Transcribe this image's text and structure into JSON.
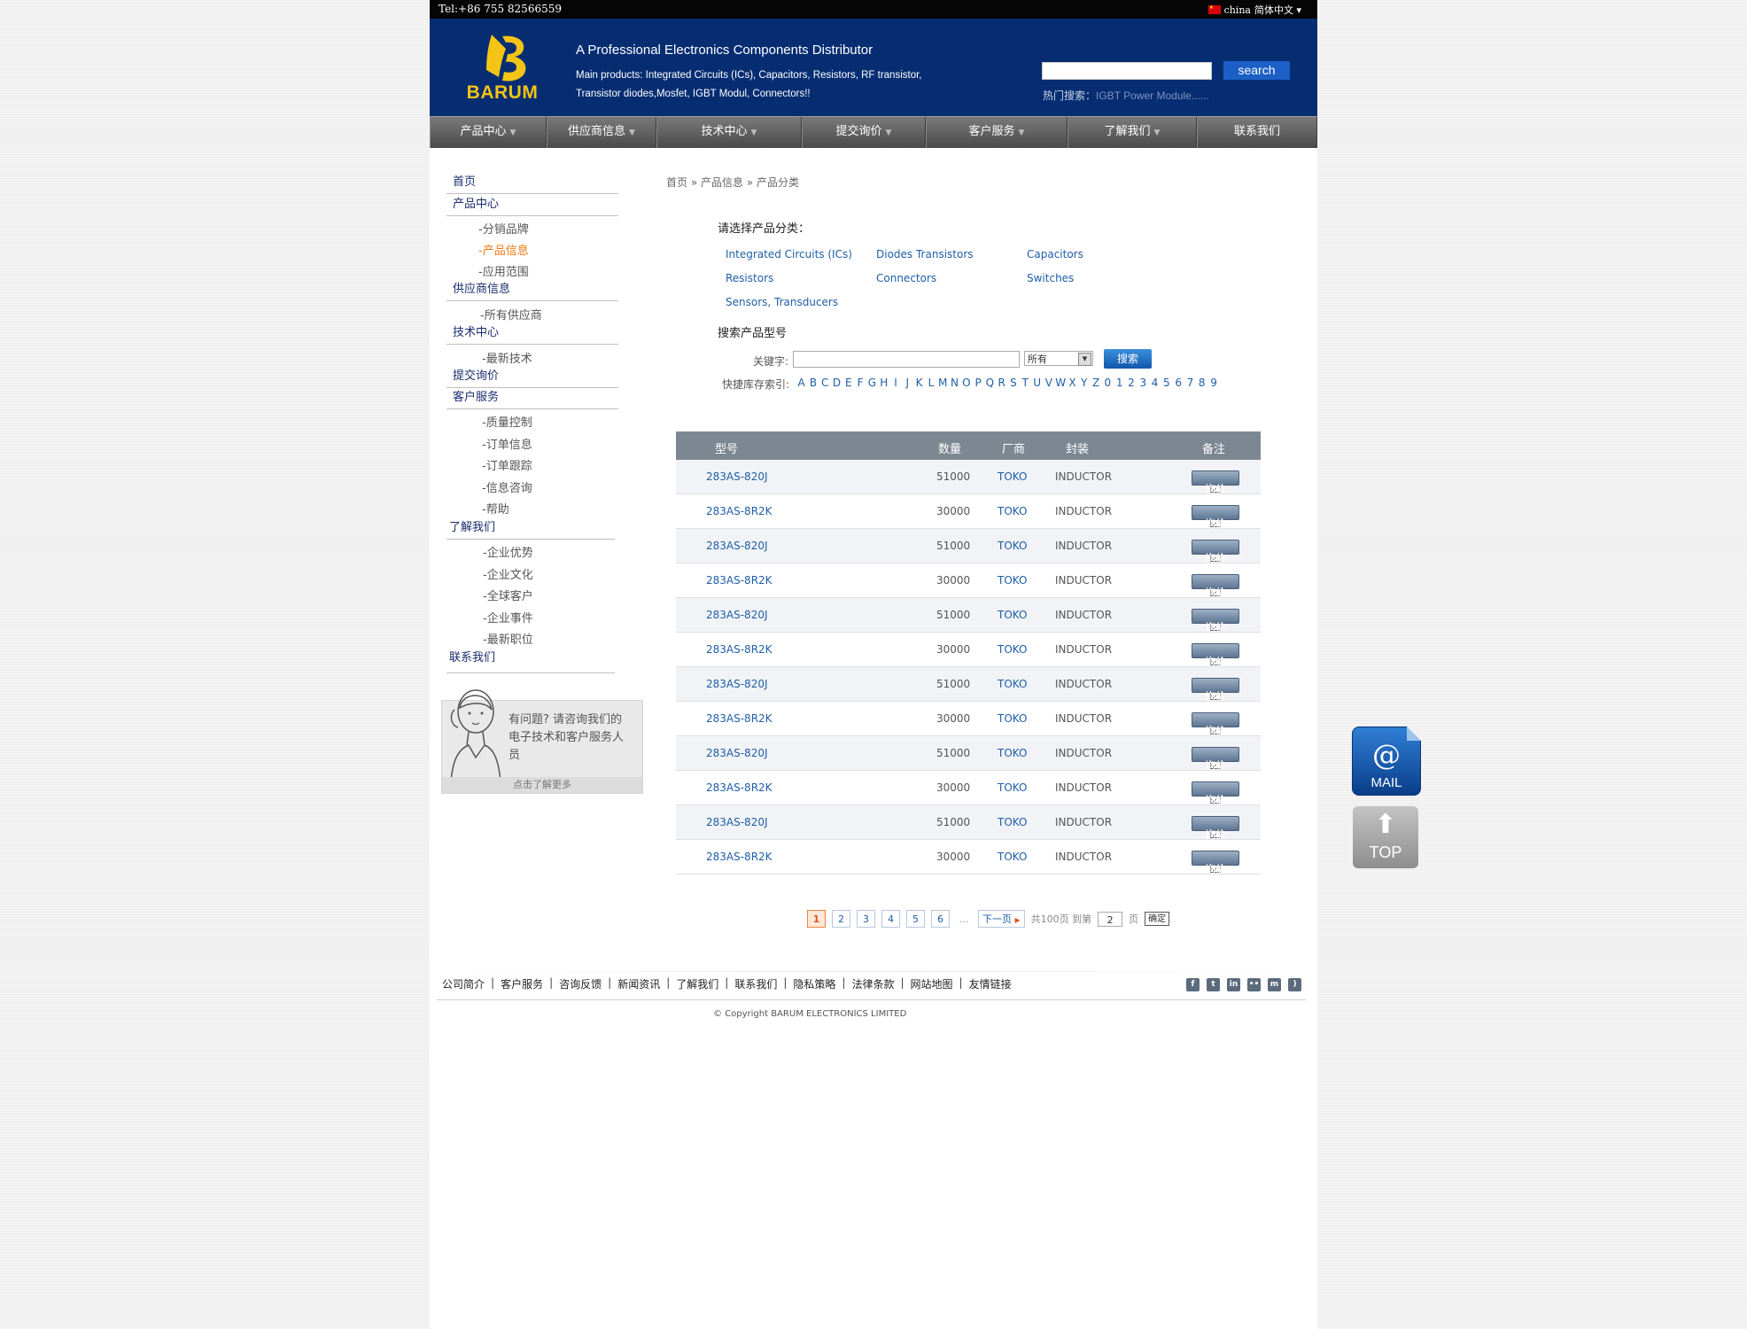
{
  "topbar": {
    "tel": "Tel:+86 755 82566559",
    "region": "china",
    "language": "简体中文 ▾"
  },
  "header": {
    "logo_text": "BARUM",
    "tagline": "A Professional Electronics Components Distributor",
    "main_products": "Main products: Integrated Circuits (ICs), Capacitors, Resistors, RF transistor, Transistor diodes,Mosfet, IGBT Modul, Connectors!!",
    "search_button": "search",
    "search_value": "",
    "hot_label": "热门搜索：",
    "hot_value": "IGBT Power Module......"
  },
  "nav": [
    "产品中心",
    "供应商信息",
    "技术中心",
    "提交询价",
    "客户服务",
    "了解我们",
    "联系我们"
  ],
  "sidebar": {
    "home": "首页",
    "product_center": "产品中心",
    "brands": "-分销品牌",
    "product_info": "-产品信息",
    "application": "-应用范围",
    "supplier_info": "供应商信息",
    "all_suppliers": "-所有供应商",
    "tech_center": "技术中心",
    "latest_tech": "-最新技术",
    "submit_inquiry": "提交询价",
    "customer_service": "客户服务",
    "quality": "-质量控制",
    "order_info": "-订单信息",
    "order_track": "-订单跟踪",
    "info_consult": "-信息咨询",
    "help": "-帮助",
    "about": "了解我们",
    "advantage": "-企业优势",
    "culture": "-企业文化",
    "global_clients": "-全球客户",
    "events": "-企业事件",
    "jobs": "-最新职位",
    "contact": "联系我们",
    "help_box_text": "有问题? 请咨询我们的电子技术和客户服务人员",
    "help_box_more": "点击了解更多"
  },
  "breadcrumb": "首页 » 产品信息 » 产品分类",
  "categories": {
    "title": "请选择产品分类：",
    "items": [
      "Integrated Circuits (ICs)",
      "Diodes Transistors",
      "Capacitors",
      "Resistors",
      "Connectors",
      "Switches",
      "Sensors, Transducers"
    ]
  },
  "search": {
    "title": "搜索产品型号",
    "keyword_label": "关键字:",
    "keyword_value": "",
    "select_value": "所有",
    "button": "搜索",
    "quick_label": "快捷库存索引:",
    "letters": [
      "A",
      "B",
      "C",
      "D",
      "E",
      "F",
      "G",
      "H",
      "I",
      "J",
      "K",
      "L",
      "M",
      "N",
      "O",
      "P",
      "Q",
      "R",
      "S",
      "T",
      "U",
      "V",
      "W",
      "X",
      "Y",
      "Z",
      "0",
      "1",
      "2",
      "3",
      "4",
      "5",
      "6",
      "7",
      "8",
      "9"
    ]
  },
  "table": {
    "headers": {
      "model": "型号",
      "qty": "数量",
      "brand": "厂商",
      "package": "封装",
      "note": "备注"
    },
    "ask_label": "询价",
    "rows": [
      {
        "model": "283AS-820J",
        "qty": "51000",
        "brand": "TOKO",
        "package": "INDUCTOR"
      },
      {
        "model": "283AS-8R2K",
        "qty": "30000",
        "brand": "TOKO",
        "package": "INDUCTOR"
      },
      {
        "model": "283AS-820J",
        "qty": "51000",
        "brand": "TOKO",
        "package": "INDUCTOR"
      },
      {
        "model": "283AS-8R2K",
        "qty": "30000",
        "brand": "TOKO",
        "package": "INDUCTOR"
      },
      {
        "model": "283AS-820J",
        "qty": "51000",
        "brand": "TOKO",
        "package": "INDUCTOR"
      },
      {
        "model": "283AS-8R2K",
        "qty": "30000",
        "brand": "TOKO",
        "package": "INDUCTOR"
      },
      {
        "model": "283AS-820J",
        "qty": "51000",
        "brand": "TOKO",
        "package": "INDUCTOR"
      },
      {
        "model": "283AS-8R2K",
        "qty": "30000",
        "brand": "TOKO",
        "package": "INDUCTOR"
      },
      {
        "model": "283AS-820J",
        "qty": "51000",
        "brand": "TOKO",
        "package": "INDUCTOR"
      },
      {
        "model": "283AS-8R2K",
        "qty": "30000",
        "brand": "TOKO",
        "package": "INDUCTOR"
      },
      {
        "model": "283AS-820J",
        "qty": "51000",
        "brand": "TOKO",
        "package": "INDUCTOR"
      },
      {
        "model": "283AS-8R2K",
        "qty": "30000",
        "brand": "TOKO",
        "package": "INDUCTOR"
      }
    ]
  },
  "pager": {
    "pages": [
      "1",
      "2",
      "3",
      "4",
      "5",
      "6"
    ],
    "current": "1",
    "ellipsis": "…",
    "next": "下一页",
    "total": "共100页 到第",
    "goto_value": "2",
    "page_unit": "页",
    "ok": "确定"
  },
  "footer": {
    "links": [
      "公司简介",
      "客户服务",
      "咨询反馈",
      "新闻资讯",
      "了解我们",
      "联系我们",
      "隐私策略",
      "法律条款",
      "网站地图",
      "友情链接"
    ],
    "copyright": "© Copyright BARUM ELECTRONICS LIMITED"
  },
  "floating": {
    "mail_label": "MAIL",
    "top_label": "TOP"
  },
  "colors": {
    "header_bg": "#062d72",
    "logo": "#f3c316",
    "link": "#1f5ea8",
    "active": "#ee7a10",
    "table_header": "#7c8791"
  }
}
